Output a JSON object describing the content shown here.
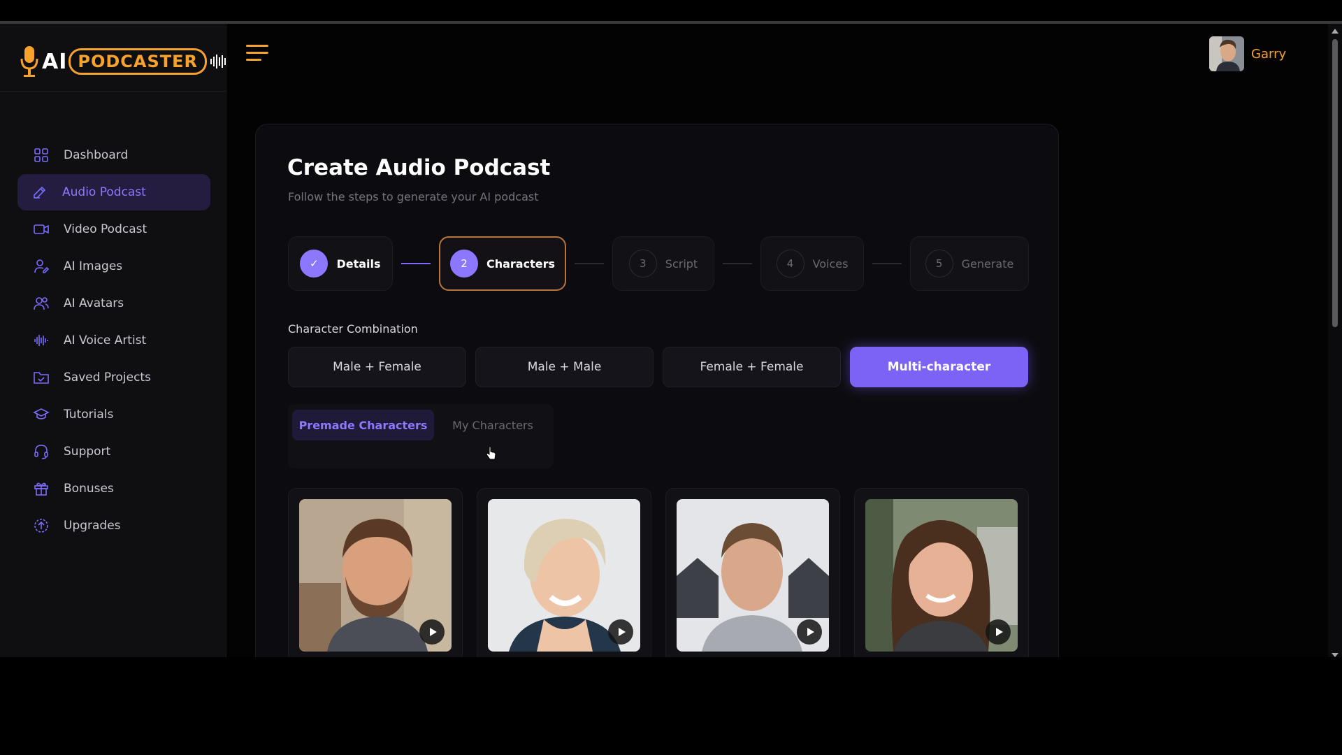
{
  "brand": {
    "logo_ai": "AI",
    "logo_name": "PODCASTER"
  },
  "colors": {
    "accent": "#7c62f5",
    "brand_orange": "#f6a22b",
    "background": "#030303",
    "sidebar": "#0f0f12"
  },
  "sidebar": {
    "items": [
      {
        "label": "Dashboard",
        "icon": "grid-icon",
        "active": false
      },
      {
        "label": "Audio Podcast",
        "icon": "pen-icon",
        "active": true
      },
      {
        "label": "Video Podcast",
        "icon": "video-camera-icon",
        "active": false
      },
      {
        "label": "AI Images",
        "icon": "user-edit-icon",
        "active": false
      },
      {
        "label": "AI Avatars",
        "icon": "users-icon",
        "active": false
      },
      {
        "label": "AI Voice Artist",
        "icon": "waveform-icon",
        "active": false
      },
      {
        "label": "Saved Projects",
        "icon": "folder-check-icon",
        "active": false
      },
      {
        "label": "Tutorials",
        "icon": "graduation-cap-icon",
        "active": false
      },
      {
        "label": "Support",
        "icon": "headset-icon",
        "active": false
      },
      {
        "label": "Bonuses",
        "icon": "gift-icon",
        "active": false
      },
      {
        "label": "Upgrades",
        "icon": "upgrade-arrow-icon",
        "active": false
      }
    ]
  },
  "header": {
    "menu_icon": "hamburger-icon",
    "user_name": "Garry"
  },
  "page": {
    "title": "Create Audio Podcast",
    "subtitle": "Follow the steps to generate your AI podcast"
  },
  "steps": [
    {
      "num": "✓",
      "label": "Details",
      "state": "done"
    },
    {
      "num": "2",
      "label": "Characters",
      "state": "current"
    },
    {
      "num": "3",
      "label": "Script",
      "state": "pending"
    },
    {
      "num": "4",
      "label": "Voices",
      "state": "pending"
    },
    {
      "num": "5",
      "label": "Generate",
      "state": "pending"
    }
  ],
  "character_combination": {
    "label": "Character Combination",
    "options": [
      "Male + Female",
      "Male + Male",
      "Female + Female",
      "Multi-character"
    ],
    "selected": "Multi-character"
  },
  "character_tabs": {
    "options": [
      "Premade Characters",
      "My Characters"
    ],
    "active": "Premade Characters"
  },
  "characters": [
    {
      "description_icon": "play-icon"
    },
    {
      "description_icon": "play-icon"
    },
    {
      "description_icon": "play-icon"
    },
    {
      "description_icon": "play-icon"
    }
  ]
}
